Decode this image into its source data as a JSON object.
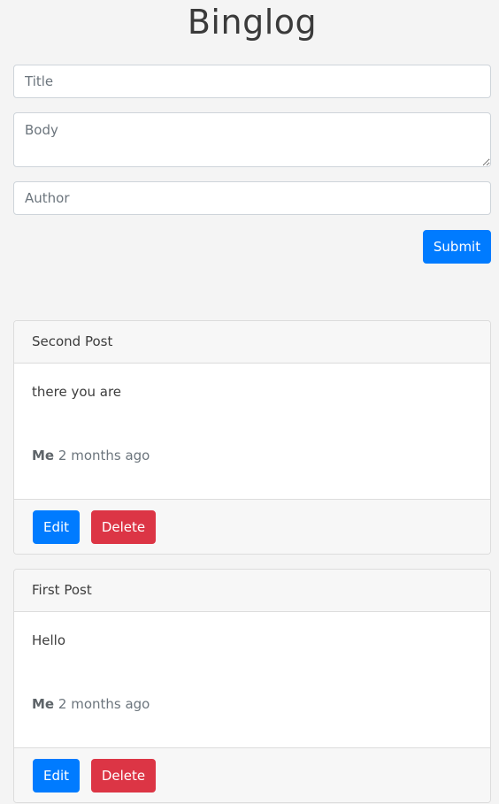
{
  "app": {
    "title": "Binglog"
  },
  "form": {
    "title_placeholder": "Title",
    "title_value": "",
    "body_placeholder": "Body",
    "body_value": "",
    "author_placeholder": "Author",
    "author_value": "",
    "submit_label": "Submit"
  },
  "posts": [
    {
      "title": "Second Post",
      "body": "there you are",
      "author": "Me",
      "time": "2 months ago",
      "edit_label": "Edit",
      "delete_label": "Delete"
    },
    {
      "title": "First Post",
      "body": "Hello",
      "author": "Me",
      "time": "2 months ago",
      "edit_label": "Edit",
      "delete_label": "Delete"
    }
  ],
  "colors": {
    "background": "#f4f4f4",
    "primary": "#007bff",
    "danger": "#dc3545",
    "muted": "#6c757d"
  }
}
